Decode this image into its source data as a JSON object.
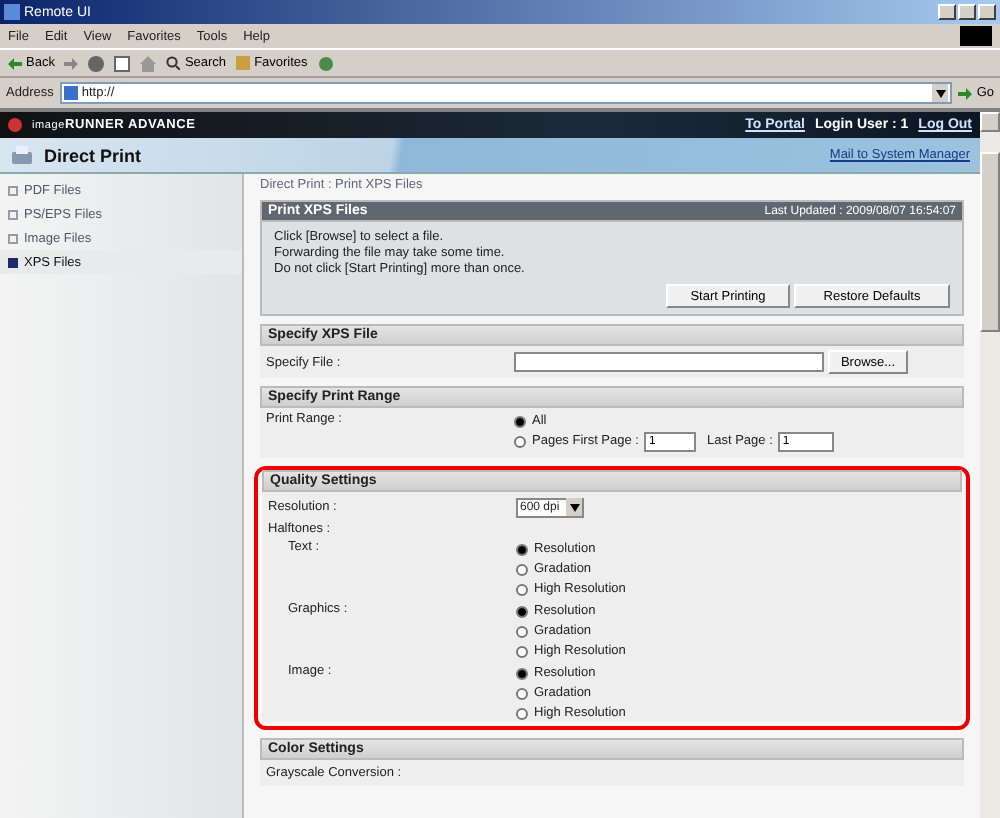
{
  "window": {
    "title": "Remote UI"
  },
  "menu": [
    "File",
    "Edit",
    "View",
    "Favorites",
    "Tools",
    "Help"
  ],
  "toolbar": {
    "back": "Back",
    "search": "Search",
    "favorites": "Favorites"
  },
  "address": {
    "label": "Address",
    "value": "http://",
    "go": "Go"
  },
  "header": {
    "brand_prefix": "image",
    "brand": "RUNNER ADVANCE",
    "to_portal": "To Portal",
    "login_user": "Login User : 1",
    "log_out": "Log Out",
    "title": "Direct Print",
    "mail": "Mail to System Manager"
  },
  "sidebar": {
    "items": [
      {
        "label": "PDF Files",
        "selected": false
      },
      {
        "label": "PS/EPS Files",
        "selected": false
      },
      {
        "label": "Image Files",
        "selected": false
      },
      {
        "label": "XPS Files",
        "selected": true
      }
    ]
  },
  "breadcrumb": "Direct Print : Print XPS Files",
  "print_box": {
    "title": "Print XPS Files",
    "last_updated": "Last Updated : 2009/08/07 16:54:07",
    "messages": [
      "Click [Browse] to select a file.",
      "Forwarding the file may take some time.",
      "Do not click [Start Printing] more than once."
    ],
    "buttons": [
      "Start Printing",
      "Restore Defaults"
    ]
  },
  "specify_file": {
    "title": "Specify XPS File",
    "label": "Specify File :",
    "browse": "Browse..."
  },
  "print_range": {
    "title": "Specify Print Range",
    "label": "Print Range :",
    "options": [
      {
        "label": "All",
        "selected": true
      },
      {
        "label": "Pages First Page :",
        "selected": false
      }
    ],
    "first_page": "1",
    "last_page_label": "Last Page :",
    "last_page": "1"
  },
  "quality": {
    "title": "Quality Settings",
    "highlighted": true,
    "resolution_label": "Resolution :",
    "resolution": "600 dpi",
    "halftones_label": "Halftones :",
    "groups": [
      {
        "label": "Text :",
        "options": [
          {
            "label": "Resolution",
            "selected": true
          },
          {
            "label": "Gradation",
            "selected": false
          },
          {
            "label": "High Resolution",
            "selected": false
          }
        ]
      },
      {
        "label": "Graphics :",
        "options": [
          {
            "label": "Resolution",
            "selected": true
          },
          {
            "label": "Gradation",
            "selected": false
          },
          {
            "label": "High Resolution",
            "selected": false
          }
        ]
      },
      {
        "label": "Image :",
        "options": [
          {
            "label": "Resolution",
            "selected": true
          },
          {
            "label": "Gradation",
            "selected": false
          },
          {
            "label": "High Resolution",
            "selected": false
          }
        ]
      }
    ]
  },
  "color": {
    "title": "Color Settings",
    "label": "Grayscale Conversion :"
  }
}
